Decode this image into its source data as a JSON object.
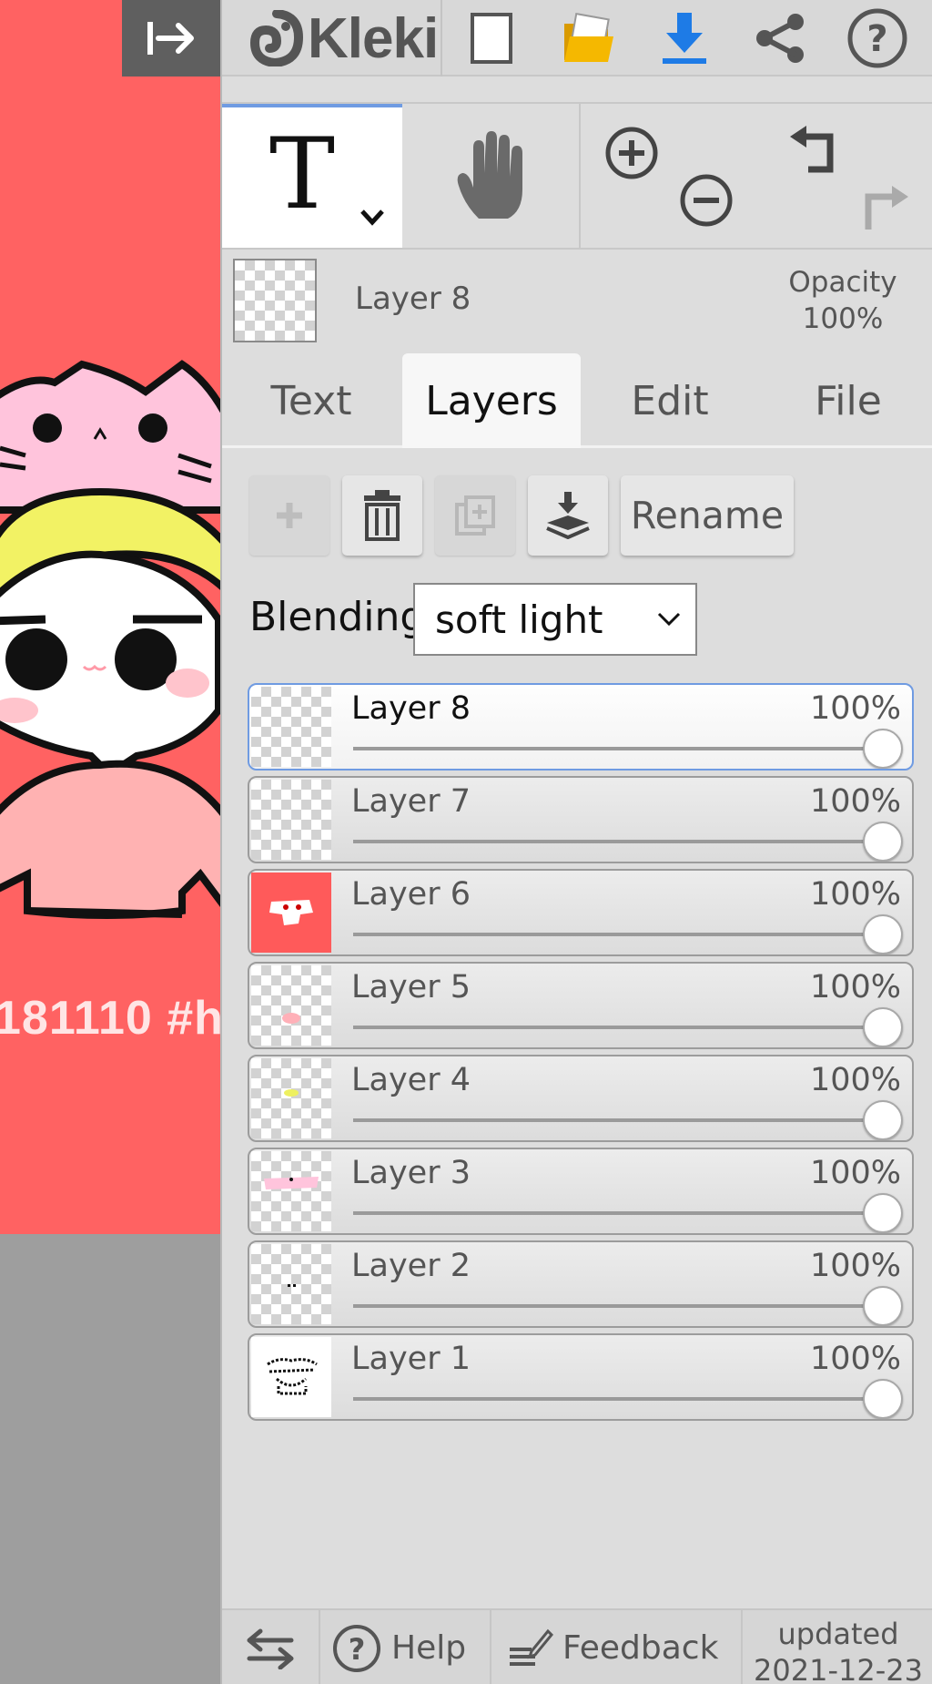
{
  "app": {
    "logo_text": "Kleki"
  },
  "canvas": {
    "caption": "181110 #h",
    "background_color": "#ff6262"
  },
  "topbar": {
    "icons": [
      "collapse-panel-icon",
      "new-image-icon",
      "open-folder-icon",
      "download-icon",
      "share-icon",
      "help-icon"
    ]
  },
  "tools": {
    "text_tool_glyph": "T",
    "active_tool": "text"
  },
  "current_layer": {
    "name": "Layer 8",
    "opacity_label": "Opacity",
    "opacity_value": "100%"
  },
  "tabs": [
    {
      "label": "Text"
    },
    {
      "label": "Layers"
    },
    {
      "label": "Edit"
    },
    {
      "label": "File"
    }
  ],
  "active_tab": "Layers",
  "layer_actions": {
    "rename_label": "Rename"
  },
  "blending": {
    "label": "Blending",
    "value": "soft light"
  },
  "layers": [
    {
      "name": "Layer 8",
      "opacity": "100%",
      "selected": true
    },
    {
      "name": "Layer 7",
      "opacity": "100%",
      "selected": false
    },
    {
      "name": "Layer 6",
      "opacity": "100%",
      "selected": false
    },
    {
      "name": "Layer 5",
      "opacity": "100%",
      "selected": false
    },
    {
      "name": "Layer 4",
      "opacity": "100%",
      "selected": false
    },
    {
      "name": "Layer 3",
      "opacity": "100%",
      "selected": false
    },
    {
      "name": "Layer 2",
      "opacity": "100%",
      "selected": false
    },
    {
      "name": "Layer 1",
      "opacity": "100%",
      "selected": false
    }
  ],
  "footer": {
    "help_label": "Help",
    "feedback_label": "Feedback",
    "updated_line1": "updated",
    "updated_line2": "2021-12-23"
  },
  "colors": {
    "accent": "#6f9be2",
    "download_blue": "#1e7be6",
    "folder_yellow": "#f5b800"
  }
}
